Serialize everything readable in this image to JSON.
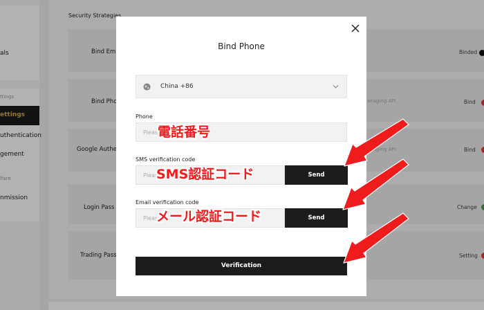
{
  "background": {
    "sidebar": {
      "item_als": "als",
      "group_settings": "ttings",
      "active_item": "ettings",
      "item_authentication": "uthentication",
      "item_management": "gement",
      "group_welfare": "lfare",
      "item_commission": "nmission"
    },
    "section_title": "Security Strategies",
    "rows": [
      {
        "label": "Bind Ema",
        "right": "Binded"
      },
      {
        "label": "Bind Pho",
        "middle": "anaging API.",
        "right": "Bind"
      },
      {
        "label": "Google Authe",
        "middle": "anaging API.",
        "right": "Bind"
      },
      {
        "label": "Login Pass",
        "right": "Change"
      },
      {
        "label": "Trading Pass",
        "right": "Setting"
      }
    ]
  },
  "modal": {
    "title": "Bind Phone",
    "country": {
      "value": "China +86"
    },
    "phone": {
      "label": "Phone",
      "placeholder": "Please..."
    },
    "sms": {
      "label": "SMS verification code",
      "placeholder": "Please...",
      "send_label": "Send"
    },
    "email": {
      "label": "Email verification code",
      "placeholder": "Please...",
      "send_label": "Send"
    },
    "verify_label": "Verification"
  },
  "annotations": {
    "phone": "電話番号",
    "sms": "SMS認証コード",
    "email": "メール認証コード"
  },
  "colors": {
    "accent_dark": "#1c1c1c",
    "annotation_red": "#ee1c1c",
    "status_red": "#e53935",
    "status_green": "#43a047",
    "sidebar_gold": "#d8a94a"
  },
  "icons": {
    "close": "close-icon",
    "globe": "globe-icon",
    "dropdown": "chevron-down-icon"
  }
}
